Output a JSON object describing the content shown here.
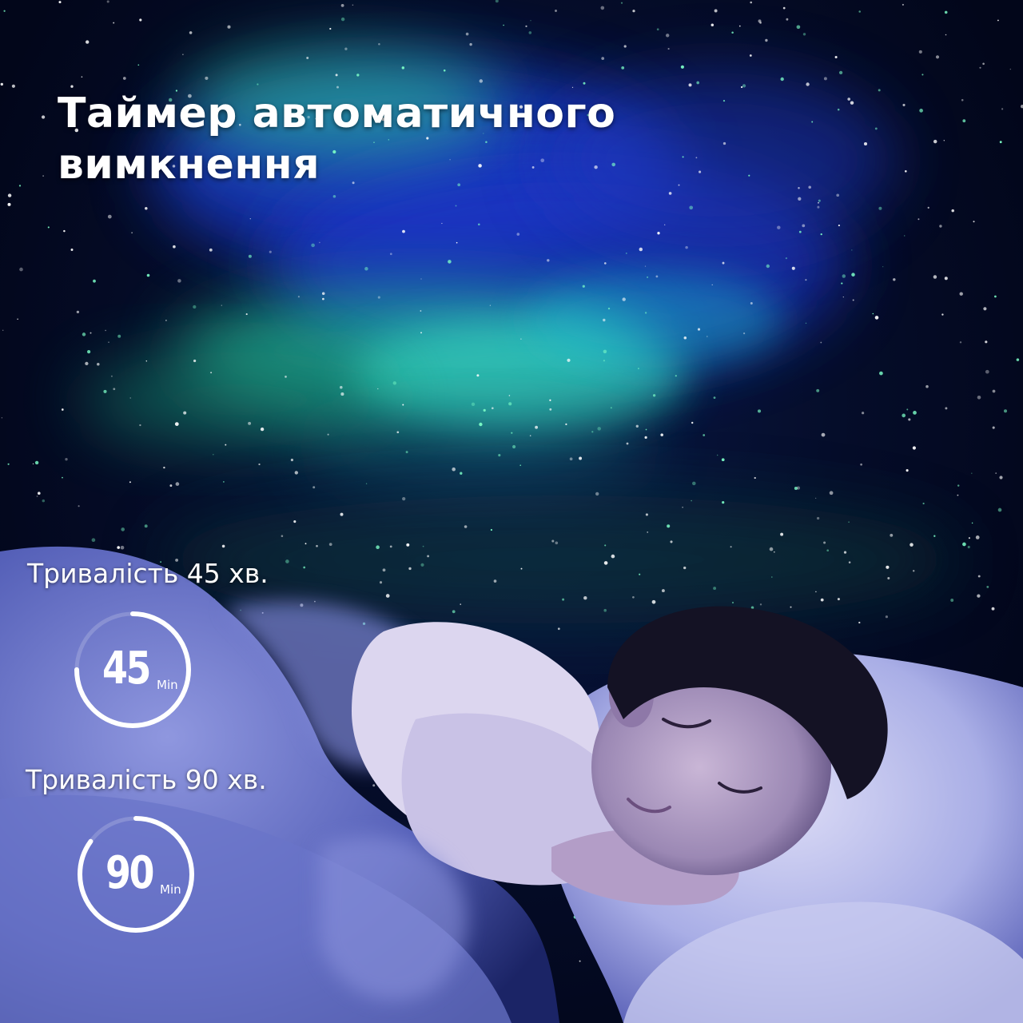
{
  "headline": {
    "line1": "Таймер автоматичного",
    "line2": "вимкнення"
  },
  "timers": [
    {
      "label": "Тривалість 45 хв.",
      "value": "45",
      "unit": "Min",
      "progress": 0.75
    },
    {
      "label": "Тривалість 90 хв.",
      "value": "90",
      "unit": "Min",
      "progress": 0.85
    }
  ],
  "colors": {
    "text": "#ffffff",
    "ring": "#ffffff",
    "aurora_green": "#2fd9a0",
    "aurora_blue": "#1f3fd8",
    "night_sky": "#050d2a"
  }
}
